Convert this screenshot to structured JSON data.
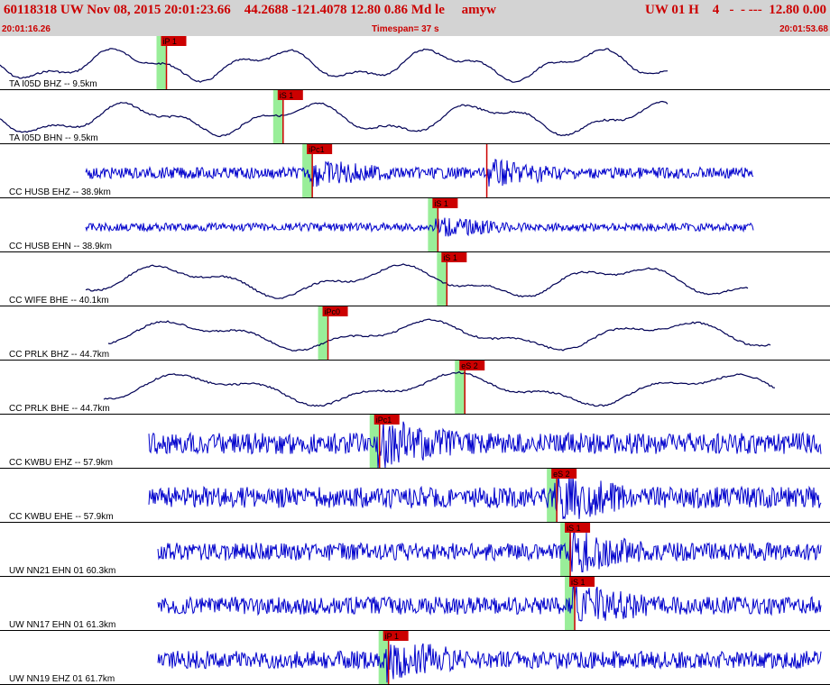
{
  "header": {
    "event_line": "60118318 UW Nov 08, 2015 20:01:23.66    44.2688 -121.4078 12.80 0.86 Md le     amyw",
    "status_line": "UW 01 H    4   -  - ---  12.80 0.00"
  },
  "timebar": {
    "start": "20:01:16.26",
    "span": "Timespan=  37 s",
    "end": "20:01:53.68"
  },
  "colors": {
    "background": "#ffffff",
    "header_bg": "#d3d3d3",
    "header_text": "#cc0000",
    "trace_broadband": "#000055",
    "trace_short_period": "#0000cc",
    "pick_marker": "#cc0000",
    "pick_window": "#99ee99",
    "separator": "#000000"
  },
  "traces": [
    {
      "label": "TA I05D BHZ -- 9.5km",
      "kind": "broad",
      "picks": [
        {
          "name": "iP 1",
          "t": 7.3
        }
      ]
    },
    {
      "label": "TA I05D BHN -- 9.5km",
      "kind": "broad",
      "picks": [
        {
          "name": "iS 1",
          "t": 12.5
        }
      ]
    },
    {
      "label": "CC HUSB EHZ -- 38.9km",
      "kind": "sp",
      "picks": [
        {
          "name": "iPc1",
          "t": 13.8
        },
        {
          "name": "",
          "t": 21.7
        }
      ]
    },
    {
      "label": "CC HUSB EHN -- 38.9km",
      "kind": "sp",
      "picks": [
        {
          "name": "iS 1",
          "t": 19.4
        }
      ]
    },
    {
      "label": "CC WIFE BHE -- 40.1km",
      "kind": "broad",
      "picks": [
        {
          "name": "iS 1",
          "t": 19.8
        }
      ]
    },
    {
      "label": "CC PRLK BHZ -- 44.7km",
      "kind": "broad",
      "picks": [
        {
          "name": "iPc0",
          "t": 14.5
        }
      ]
    },
    {
      "label": "CC PRLK BHE -- 44.7km",
      "kind": "broad",
      "picks": [
        {
          "name": "eS 2",
          "t": 20.6
        }
      ]
    },
    {
      "label": "CC KWBU EHZ -- 57.9km",
      "kind": "sp",
      "picks": [
        {
          "name": "iPc1",
          "t": 16.8
        }
      ]
    },
    {
      "label": "CC KWBU EHE -- 57.9km",
      "kind": "sp",
      "picks": [
        {
          "name": "eS 2",
          "t": 24.7
        }
      ]
    },
    {
      "label": "UW NN21 EHN 01 60.3km",
      "kind": "sp",
      "picks": [
        {
          "name": "iS 1",
          "t": 25.3
        }
      ]
    },
    {
      "label": "UW NN17 EHN 01 61.3km",
      "kind": "sp",
      "picks": [
        {
          "name": "iS 1",
          "t": 25.5
        }
      ]
    },
    {
      "label": "UW NN19 EHZ 01 61.7km",
      "kind": "sp",
      "picks": [
        {
          "name": "iP 1",
          "t": 17.2
        }
      ]
    }
  ]
}
